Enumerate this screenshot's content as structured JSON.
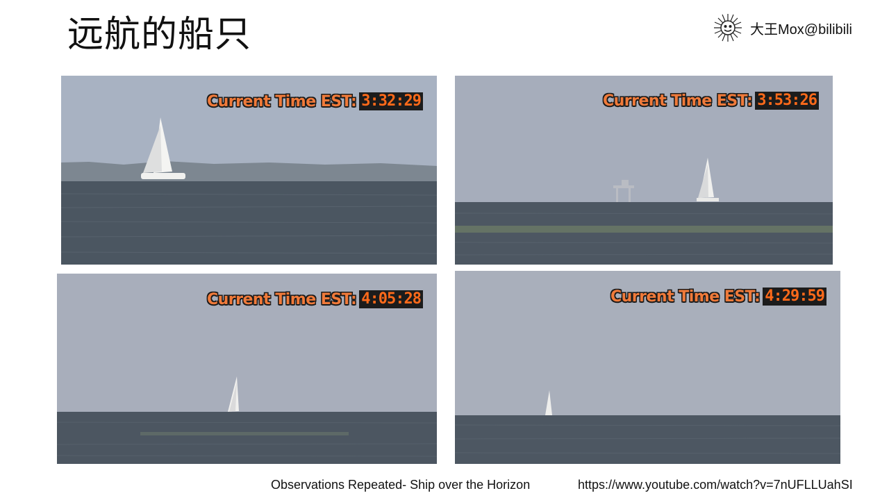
{
  "title": "远航的船只",
  "brand": {
    "icon": "sun-logo-icon",
    "text": "大王Mox@bilibili"
  },
  "overlay_label": "Current Time EST:",
  "photos": [
    {
      "clock": "3:32:29"
    },
    {
      "clock": "3:53:26"
    },
    {
      "clock": "4:05:28"
    },
    {
      "clock": "4:29:59"
    }
  ],
  "captions": {
    "source_title": "Observations Repeated- Ship over the Horizon",
    "source_url": "https://www.youtube.com/watch?v=7nUFLLUahSI"
  },
  "colors": {
    "sky": "#a9b1c0",
    "water": "#4a5560",
    "overlay_text": "#f07a3a",
    "clock_text": "#ff6a1a"
  }
}
